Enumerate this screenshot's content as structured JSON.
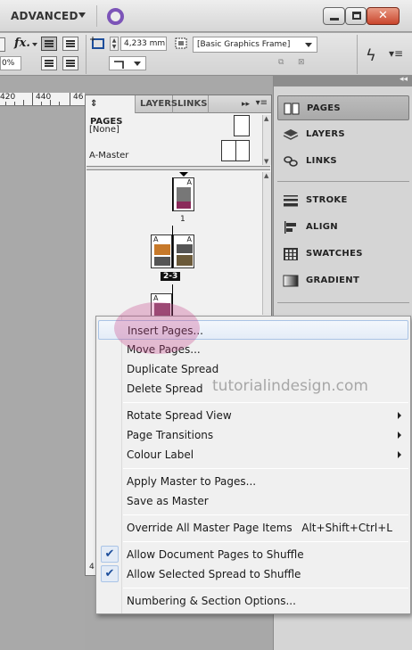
{
  "app": {
    "workspace": "ADVANCED",
    "window_controls": {
      "minimize": "minimize",
      "maximize": "maximize",
      "close": "✕"
    }
  },
  "control_bar": {
    "fx_label": "fx.",
    "zoom_value": "0%",
    "dimension_value": "4,233 mm",
    "object_style": "[Basic Graphics Frame]"
  },
  "ruler": {
    "marks": [
      "420",
      "440",
      "46"
    ]
  },
  "pages_panel": {
    "tabs": [
      "PAGES",
      "LAYERS",
      "LINKS"
    ],
    "masters": [
      "[None]",
      "A-Master"
    ],
    "page_labels": [
      "1",
      "2-3"
    ],
    "status": "4"
  },
  "dock": {
    "items": [
      "PAGES",
      "LAYERS",
      "LINKS",
      "STROKE",
      "ALIGN",
      "SWATCHES",
      "GRADIENT"
    ]
  },
  "context_menu": {
    "groups": [
      [
        "Insert Pages...",
        "Move Pages...",
        "Duplicate Spread",
        "Delete Spread"
      ],
      [
        "Rotate Spread View",
        "Page Transitions",
        "Colour Label"
      ],
      [
        "Apply Master to Pages...",
        "Save as Master"
      ],
      [
        "Override All Master Page Items"
      ],
      [
        "Allow Document Pages to Shuffle",
        "Allow Selected Spread to Shuffle"
      ],
      [
        "Numbering & Section Options..."
      ]
    ],
    "override_shortcut": "Alt+Shift+Ctrl+L"
  },
  "watermark": "tutorialindesign.com",
  "colors": {
    "highlight": "#c8468c",
    "accent_purple": "#7c54b8",
    "hover": "#e4ecf7"
  }
}
